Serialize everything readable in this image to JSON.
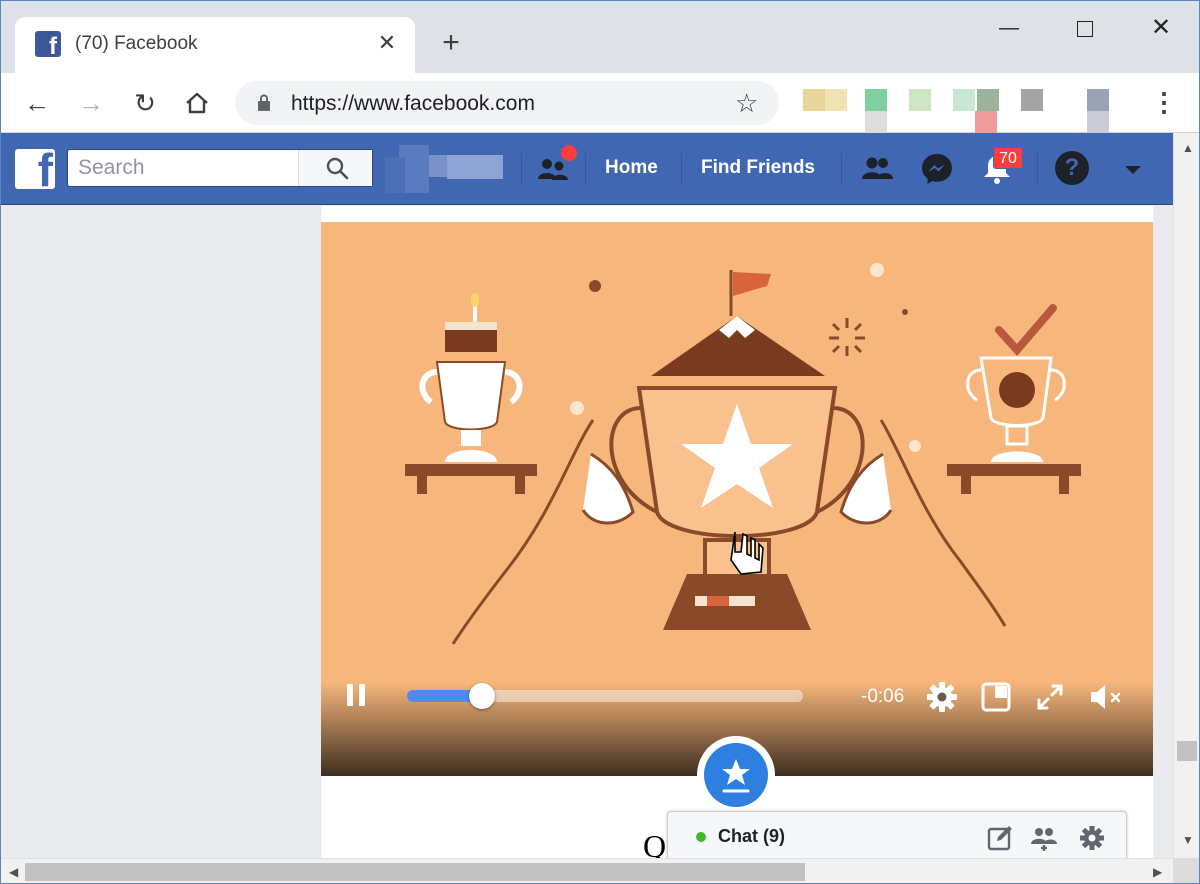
{
  "browser": {
    "tab_title": "(70) Facebook",
    "url": "https://www.facebook.com",
    "close_tab_glyph": "✕",
    "new_tab_glyph": "+",
    "minimize_glyph": "—",
    "close_window_glyph": "✕",
    "back_glyph": "←",
    "forward_glyph": "→",
    "reload_glyph": "↻",
    "menu_glyph": "⋮",
    "bookmark_glyph": "☆"
  },
  "facebook": {
    "search_placeholder": "Search",
    "nav_home": "Home",
    "nav_find_friends": "Find Friends",
    "notifications_count": "70",
    "help_glyph": "?",
    "brand_color": "#4267b2"
  },
  "video": {
    "time_remaining": "-0:06",
    "progress_fraction": 0.19
  },
  "chat": {
    "label": "Chat (9)"
  },
  "stray_text": "Q"
}
